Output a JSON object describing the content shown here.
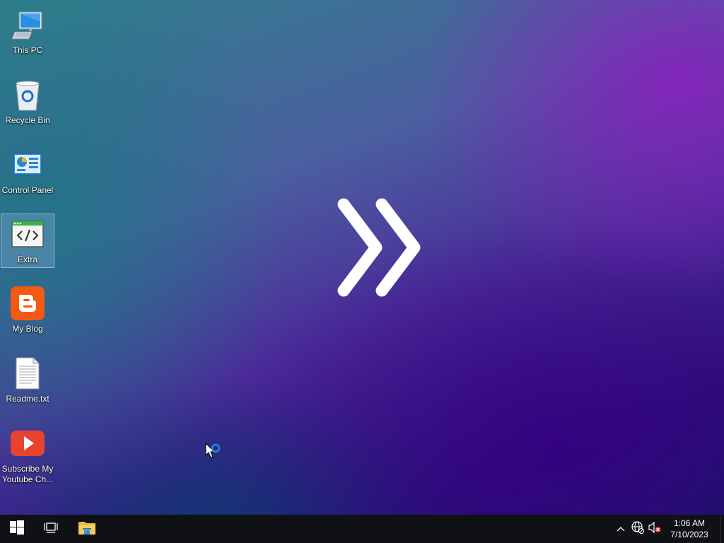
{
  "desktop": {
    "icons": [
      {
        "label": "This PC",
        "icon": "computer-icon"
      },
      {
        "label": "Recycle Bin",
        "icon": "recycle-bin-icon"
      },
      {
        "label": "Control Panel",
        "icon": "control-panel-icon"
      },
      {
        "label": "Extra",
        "icon": "code-window-icon",
        "selected": true
      },
      {
        "label": "My Blog",
        "icon": "blogger-icon"
      },
      {
        "label": "Readme.txt",
        "icon": "text-file-icon"
      },
      {
        "label": "Subscribe My Youtube Ch...",
        "icon": "youtube-icon"
      }
    ],
    "center_logo": "double-chevron-right-icon"
  },
  "taskbar": {
    "start": "windows-start-icon",
    "task_view": "task-view-icon",
    "pinned": [
      "file-explorer-icon"
    ],
    "tray": {
      "icons": [
        "chevron-up-icon",
        "network-icon",
        "volume-muted-icon"
      ],
      "time": "1:06 AM",
      "date": "7/10/2023"
    }
  },
  "colors": {
    "taskbar_bg": "#101114",
    "accent": "#2b7fd9",
    "blogger_orange": "#f25a14",
    "youtube_red": "#e8432e"
  }
}
